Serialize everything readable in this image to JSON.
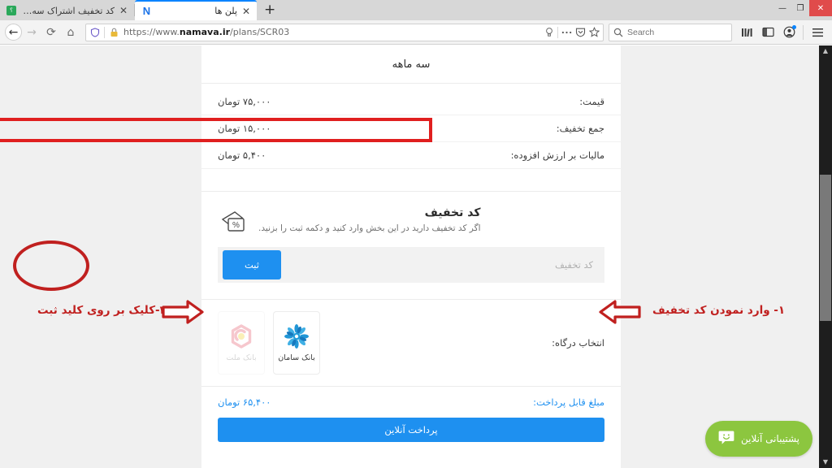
{
  "window": {
    "controls": {
      "minimize": "—",
      "maximize": "❐",
      "close": "✕"
    }
  },
  "tabs": [
    {
      "title": "کد تخفیف اشتراک سه ماهه نماوا",
      "favicon": "green-square-icon",
      "active": false,
      "close": "✕"
    },
    {
      "title": "پلن ها",
      "favicon": "namava-n-icon",
      "active": true,
      "close": "✕"
    }
  ],
  "newtab_label": "+",
  "nav": {
    "back": "←",
    "forward": "→",
    "reload": "⟳",
    "home": "⌂",
    "url": "https://www.namava.ir/plans/SCR03",
    "url_domain": "namava.ir",
    "url_scheme": "https://www.",
    "url_path": "/plans/SCR03",
    "shield_icon": "shield-icon",
    "lock_icon": "padlock-icon",
    "reader_icon": "lightbulb-icon",
    "more_icon": "ellipsis-icon",
    "pocket_icon": "pocket-icon",
    "bookmark_icon": "star-icon"
  },
  "search": {
    "placeholder": "Search",
    "icon": "search-icon"
  },
  "toolbar_icons": {
    "library": "library-icon",
    "sidebar": "sidebar-icon",
    "account": "account-icon",
    "menu": "hamburger-menu-icon"
  },
  "page": {
    "title": "سه ماهه",
    "rows": [
      {
        "label": "قیمت:",
        "value": "۷۵,۰۰۰ تومان",
        "highlighted": false
      },
      {
        "label": "جمع تخفیف:",
        "value": "۱۵,۰۰۰ تومان",
        "highlighted": true
      },
      {
        "label": "مالیات بر ارزش افزوده:",
        "value": "۵,۴۰۰ تومان",
        "highlighted": false
      }
    ],
    "coupon": {
      "heading": "کد تخفیف",
      "description": "اگر کد تخفیف دارید در این بخش وارد کنید و دکمه ثبت را بزنید.",
      "icon": "percent-coupon-icon",
      "input_value": "",
      "input_placeholder": "کد تخفیف",
      "submit_label": "ثبت"
    },
    "gateway": {
      "label": "انتخاب درگاه:",
      "options": [
        {
          "name": "بانک ملت",
          "icon": "bank-mellat-logo",
          "selected": false
        },
        {
          "name": "بانک سامان",
          "icon": "bank-saman-logo",
          "selected": true
        }
      ]
    },
    "payable": {
      "label": "مبلغ قابل پرداخت:",
      "value": "۶۵,۴۰۰ تومان"
    },
    "pay_button_label": "پرداخت آنلاین",
    "support_widget": {
      "label": "پشتیبانی آنلاین",
      "icon": "chat-smiley-icon"
    }
  },
  "annotations": [
    {
      "id": "step1",
      "text": "۱- وارد نمودن کد تخفیف"
    },
    {
      "id": "step2",
      "text": "۲-کلیک بر روی کلید ثبت"
    }
  ],
  "colors": {
    "accent_blue": "#1e90f0",
    "annotation_red": "#c0201f",
    "highlight_red": "#e01f1f",
    "support_green": "#8cc63f"
  }
}
